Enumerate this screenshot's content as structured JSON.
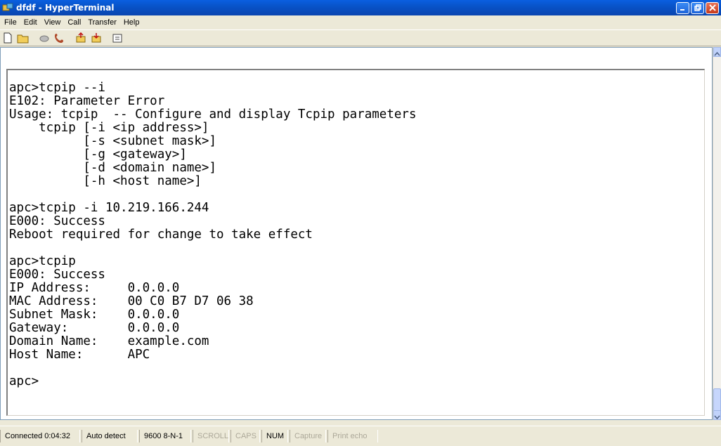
{
  "window": {
    "title": "dfdf - HyperTerminal",
    "app_icon": "hyperterminal-icon",
    "controls": [
      "minimize-icon",
      "restore-icon",
      "close-icon"
    ]
  },
  "menubar": {
    "items": [
      "File",
      "Edit",
      "View",
      "Call",
      "Transfer",
      "Help"
    ]
  },
  "toolbar": {
    "buttons": [
      "new-icon",
      "open-icon",
      "disconnect-icon",
      "phone-icon",
      "send-icon",
      "receive-icon",
      "properties-icon"
    ]
  },
  "terminal": {
    "lines": [
      "apc>tcpip --i",
      "E102: Parameter Error",
      "Usage: tcpip  -- Configure and display Tcpip parameters",
      "    tcpip [-i <ip address>]",
      "          [-s <subnet mask>]",
      "          [-g <gateway>]",
      "          [-d <domain name>]",
      "          [-h <host name>]",
      "",
      "apc>tcpip -i 10.219.166.244",
      "E000: Success",
      "Reboot required for change to take effect",
      "",
      "apc>tcpip",
      "E000: Success",
      "IP Address:     0.0.0.0",
      "MAC Address:    00 C0 B7 D7 06 38",
      "Subnet Mask:    0.0.0.0",
      "Gateway:        0.0.0.0",
      "Domain Name:    example.com",
      "Host Name:      APC",
      "",
      "apc>"
    ]
  },
  "statusbar": {
    "connected": "Connected 0:04:32",
    "detect": "Auto detect",
    "settings": "9600 8-N-1",
    "scroll": "SCROLL",
    "caps": "CAPS",
    "num": "NUM",
    "capture": "Capture",
    "print_echo": "Print echo"
  }
}
